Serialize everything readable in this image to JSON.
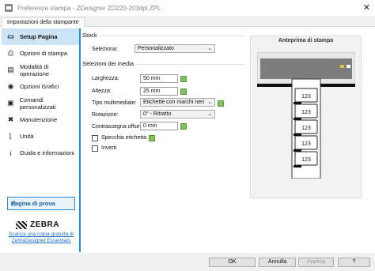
{
  "window": {
    "title": "Preferenze stampa - ZDesigner ZD220-203dpi ZPL"
  },
  "tab": {
    "label": "Impostazioni della stampante"
  },
  "sidebar": {
    "items": [
      {
        "label": "Setup Pagina",
        "icon": "page-icon"
      },
      {
        "label": "Opzioni di stampa",
        "icon": "printer-icon"
      },
      {
        "label": "Modalità di operazione",
        "icon": "operation-mode-icon"
      },
      {
        "label": "Opzioni Grafici",
        "icon": "graphics-icon"
      },
      {
        "label": "Comandi personalizzati",
        "icon": "terminal-icon"
      },
      {
        "label": "Manutenzione",
        "icon": "wrench-icon"
      },
      {
        "label": "Unità",
        "icon": "ruler-icon"
      },
      {
        "label": "Guida e informazioni",
        "icon": "help-icon"
      }
    ],
    "test_page": "Pagina di prova",
    "brand": "ZEBRA",
    "download_link": "Scarica una copia gratuita di ZebraDesigner Essentials"
  },
  "stock": {
    "heading": "Stock",
    "select_label": "Seleziona:",
    "select_value": "Personalizzato"
  },
  "media": {
    "heading": "Selezioni dei media",
    "width_label": "Larghezza:",
    "width_value": "50 mm",
    "height_label": "Altezza:",
    "height_value": "25 mm",
    "type_label": "Tipo multimediale:",
    "type_value": "Etichette con marchi neri",
    "rotation_label": "Rotazione:",
    "rotation_value": "0° - Ritratto",
    "offset_label": "Contrassegna offset:",
    "offset_value": "0 mm",
    "mirror_label": "Specchia etichetta",
    "invert_label": "Inverti"
  },
  "preview": {
    "title": "Anteprima di stampa",
    "label_text": "123"
  },
  "footer": {
    "ok": "OK",
    "cancel": "Annulla",
    "apply": "Applica",
    "help": "?"
  }
}
